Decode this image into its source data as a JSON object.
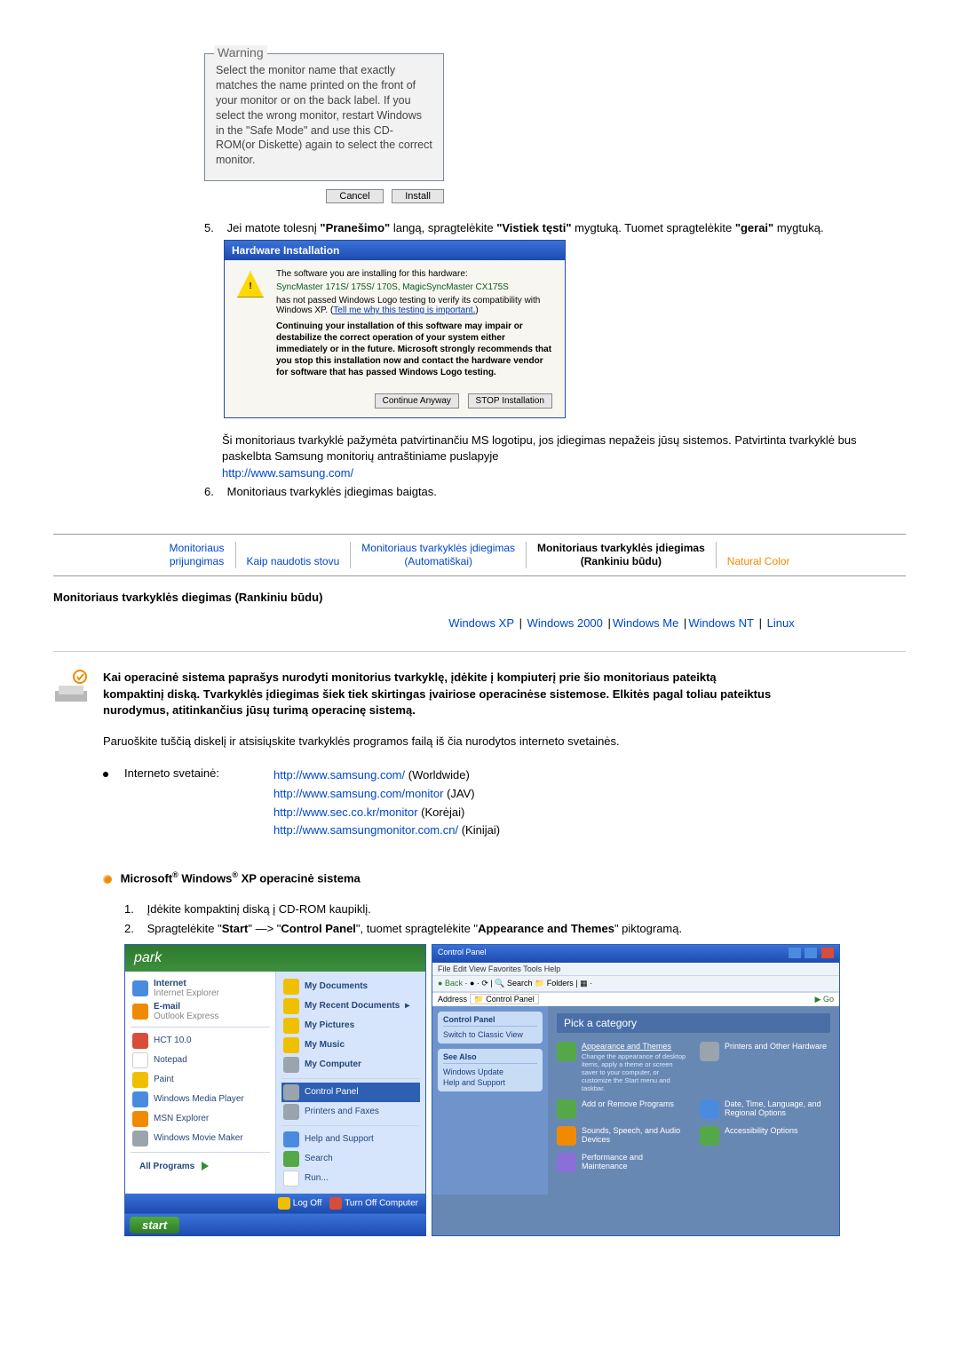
{
  "warning": {
    "legend": "Warning",
    "text": "Select the monitor name that exactly matches the name printed on the front of your monitor or on the back label. If you select the wrong monitor, restart Windows in the \"Safe Mode\" and use this CD-ROM(or Diskette) again to select the correct monitor.",
    "cancel": "Cancel",
    "install": "Install"
  },
  "step5": {
    "num": "5.",
    "text_a": "Jei matote tolesnį ",
    "b1": "\"Pranešimo\"",
    "text_b": " langą, spragtelėkite ",
    "b2": "\"Vistiek tęsti\"",
    "text_c": " mygtuką. Tuomet spragtelėkite ",
    "b3": "\"gerai\"",
    "text_d": " mygtuką."
  },
  "hwdlg": {
    "title": "Hardware Installation",
    "line1": "The software you are installing for this hardware:",
    "line2": "SyncMaster 171S/ 175S/ 170S, MagicSyncMaster CX175S",
    "line3a": "has not passed Windows Logo testing to verify its compatibility with Windows XP. (",
    "link": "Tell me why this testing is important.",
    "line3b": ")",
    "bold": "Continuing your installation of this software may impair or destabilize the correct operation of your system either immediately or in the future. Microsoft strongly recommends that you stop this installation now and contact the hardware vendor for software that has passed Windows Logo testing.",
    "btn_cont": "Continue Anyway",
    "btn_stop": "STOP Installation"
  },
  "para1a": "Ši monitoriaus tvarkyklė pažymėta patvirtinančiu MS logotipu, jos įdiegimas nepažeis jūsų sistemos. Patvirtinta tvarkyklė bus paskelbta Samsung monitorių antraštiniame puslapyje",
  "samsung_url": "http://www.samsung.com/",
  "step6": {
    "num": "6.",
    "text": "Monitoriaus tvarkyklės įdiegimas baigtas."
  },
  "tabs": {
    "t1a": "Monitoriaus",
    "t1b": "prijungimas",
    "t2": "Kaip naudotis stovu",
    "t3a": "Monitoriaus tvarkyklės įdiegimas",
    "t3b": "(Automatiškai)",
    "t4a": "Monitoriaus tvarkyklės įdiegimas",
    "t4b": "(Rankiniu būdu)",
    "t5": "Natural Color"
  },
  "section_title": "Monitoriaus tvarkyklės diegimas (Rankiniu būdu)",
  "os": {
    "xp": "Windows XP",
    "w2000": "Windows 2000",
    "wme": "Windows Me",
    "wnt": "Windows NT",
    "linux": "Linux"
  },
  "intro": "Kai operacinė sistema paprašys nurodyti monitorius tvarkyklę, įdėkite į kompiuterį prie šio monitoriaus pateiktą kompaktinį diską. Tvarkyklės įdiegimas šiek tiek skirtingas įvairiose operacinėse sistemose. Elkitės pagal toliau pateiktus nurodymus, atitinkančius jūsų turimą operacinę sistemą.",
  "intro_sub": "Paruoškite tuščią diskelį ir atsisiųskite tvarkyklės programos failą iš čia nurodytos interneto svetainės.",
  "bullet": {
    "label": "Interneto svetainė:",
    "l1_url": "http://www.samsung.com/",
    "l1_sfx": " (Worldwide)",
    "l2_url": "http://www.samsung.com/monitor",
    "l2_sfx": " (JAV)",
    "l3_url": "http://www.sec.co.kr/monitor",
    "l3_sfx": " (Korėjai)",
    "l4_url": "http://www.samsungmonitor.com.cn/",
    "l4_sfx": " (Kinijai)"
  },
  "ms_head_a": "Microsoft",
  "ms_head_b": " Windows",
  "ms_head_c": " XP operacinė sistema",
  "xp_steps": {
    "s1n": "1.",
    "s1": "Įdėkite kompaktinį diską į CD-ROM kaupiklį.",
    "s2n": "2.",
    "s2_a": "Spragtelėkite \"",
    "s2_b1": "Start",
    "s2_b": "\" —> \"",
    "s2_b2": "Control Panel",
    "s2_c": "\", tuomet spragtelėkite \"",
    "s2_b3": "Appearance and Themes",
    "s2_d": "\" piktogramą."
  },
  "startmenu": {
    "user": "park",
    "left": {
      "internet": "Internet",
      "internet_sub": "Internet Explorer",
      "email": "E-mail",
      "email_sub": "Outlook Express",
      "hct": "HCT 10.0",
      "notepad": "Notepad",
      "paint": "Paint",
      "wmp": "Windows Media Player",
      "msn": "MSN Explorer",
      "wmm": "Windows Movie Maker",
      "all": "All Programs"
    },
    "right": {
      "docs": "My Documents",
      "recent": "My Recent Documents",
      "pics": "My Pictures",
      "music": "My Music",
      "comp": "My Computer",
      "cpanel": "Control Panel",
      "printers": "Printers and Faxes",
      "help": "Help and Support",
      "search": "Search",
      "run": "Run..."
    },
    "logoff": "Log Off",
    "turnoff": "Turn Off Computer",
    "start": "start"
  },
  "cpanel": {
    "title": "Control Panel",
    "menu": "File   Edit   View   Favorites   Tools   Help",
    "toolbar_back": "Back",
    "toolbar_search": "Search",
    "toolbar_folders": "Folders",
    "addr_label": "Address",
    "addr_val": "Control Panel",
    "addr_go": "Go",
    "side_box1_hd": "Control Panel",
    "side_box1_it": "Switch to Classic View",
    "side_box2_hd": "See Also",
    "side_box2_it1": "Windows Update",
    "side_box2_it2": "Help and Support",
    "cat_hd": "Pick a category",
    "c1": "Appearance and Themes",
    "c1_sub": "Change the appearance of desktop items, apply a theme or screen saver to your computer, or customize the Start menu and taskbar.",
    "c2": "Printers and Other Hardware",
    "c3": "Add or Remove Programs",
    "c4": "Date, Time, Language, and Regional Options",
    "c5": "Sounds, Speech, and Audio Devices",
    "c6": "Accessibility Options",
    "c7": "Performance and Maintenance"
  }
}
